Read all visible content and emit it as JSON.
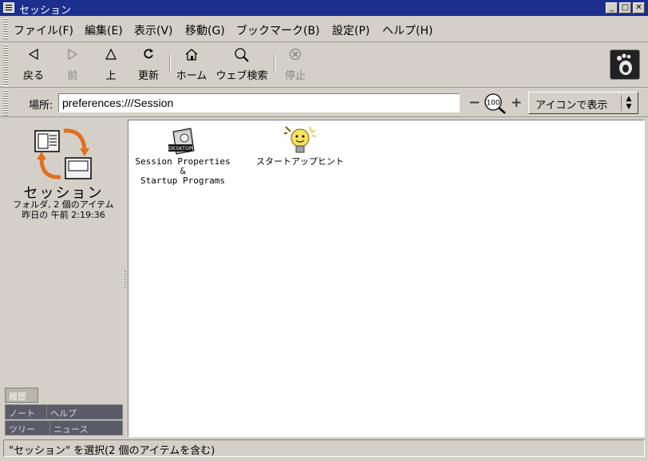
{
  "window": {
    "title": "セッション"
  },
  "menubar": [
    {
      "label": "ファイル(F)"
    },
    {
      "label": "編集(E)"
    },
    {
      "label": "表示(V)"
    },
    {
      "label": "移動(G)"
    },
    {
      "label": "ブックマーク(B)"
    },
    {
      "label": "設定(P)"
    },
    {
      "label": "ヘルプ(H)"
    }
  ],
  "toolbar": {
    "back": {
      "label": "戻る",
      "icon": "back-arrow-icon"
    },
    "forward": {
      "label": "前",
      "icon": "forward-arrow-icon"
    },
    "up": {
      "label": "上",
      "icon": "up-arrow-icon"
    },
    "refresh": {
      "label": "更新",
      "icon": "refresh-icon"
    },
    "home": {
      "label": "ホーム",
      "icon": "home-icon"
    },
    "web_search": {
      "label": "ウェブ検索",
      "icon": "search-icon"
    },
    "stop": {
      "label": "停止",
      "icon": "stop-icon"
    }
  },
  "location": {
    "label": "場所:",
    "value": "preferences:///Session",
    "zoom_level": "100",
    "view_mode": "アイコンで表示"
  },
  "sidebar": {
    "title": "セッション",
    "info_line1": "フォルダ, 2 個のアイテム",
    "info_line2": "昨日の 午前 2:19:36",
    "tabs": [
      "履歴",
      "ノート",
      "ヘルプ",
      "ツリー",
      "ニュース"
    ]
  },
  "files": [
    {
      "name_line1": "Session Properties &",
      "name_line2": "Startup Programs",
      "badge": "DESKTOP",
      "icon": "session-properties-icon"
    },
    {
      "name_line1": "スタートアップヒント",
      "name_line2": "",
      "icon": "lightbulb-icon"
    }
  ],
  "status": {
    "text": "\"セッション\" を選択(2 個のアイテムを含む)"
  },
  "colors": {
    "titlebar": "#1c2f8f",
    "chrome": "#d4d0c8",
    "content": "#ffffff"
  }
}
